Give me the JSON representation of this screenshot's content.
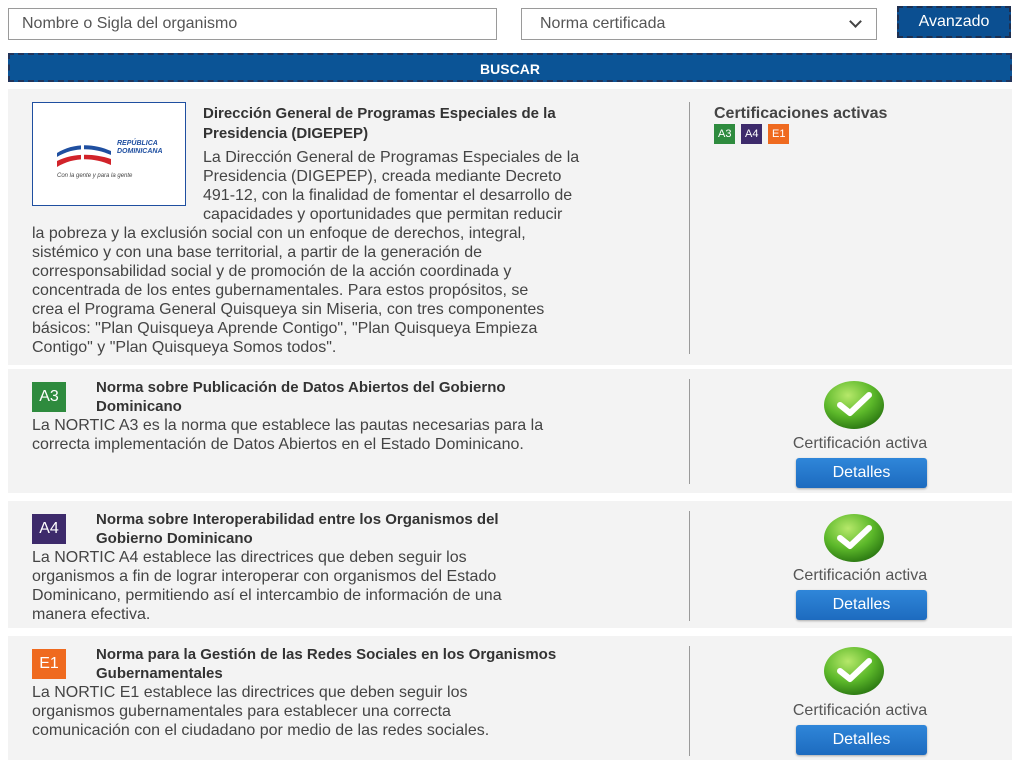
{
  "search": {
    "placeholder": "Nombre o Sigla del organismo"
  },
  "norma_select": {
    "selected": "Norma certificada"
  },
  "advanced_button": "Avanzado",
  "search_button": "BUSCAR",
  "organization": {
    "logo_text_line1": "REPÚBLICA",
    "logo_text_line2": "DOMINICANA",
    "logo_caption": "Con la gente y para la gente",
    "title_line1": "Dirección General de Programas Especiales de la",
    "title_line2": "Presidencia (DIGEPEP)",
    "description_lines_right": [
      "La Dirección General de Programas Especiales de la",
      "Presidencia (DIGEPEP), creada mediante Decreto",
      "491-12, con la finalidad de fomentar el desarrollo de",
      "capacidades y oportunidades que permitan reducir"
    ],
    "description_lines_full": [
      "la pobreza y la exclusión social con un enfoque de derechos, integral,",
      "sistémico y con una base territorial, a partir de la generación de",
      "corresponsabilidad social y de promoción de la acción coordinada y",
      "concentrada de los entes gubernamentales. Para estos propósitos, se",
      "crea el Programa General Quisqueya sin Miseria, con tres componentes",
      "básicos: \"Plan Quisqueya Aprende Contigo\", \"Plan Quisqueya Empieza",
      "Contigo\" y \"Plan Quisqueya Somos todos\"."
    ],
    "active_certs_label": "Certificaciones activas",
    "badges": [
      {
        "code": "A3",
        "color": "#2e8b3e"
      },
      {
        "code": "A4",
        "color": "#3d2a6b"
      },
      {
        "code": "E1",
        "color": "#ef6a1f"
      }
    ]
  },
  "norms": [
    {
      "code": "A3",
      "color": "#2e8b3e",
      "title_lines": [
        "Norma sobre Publicación de Datos Abiertos del Gobierno",
        "Dominicano"
      ],
      "desc_lines": [
        "La NORTIC A3 es la norma que establece las pautas necesarias para la",
        "correcta implementación de Datos Abiertos en el Estado Dominicano."
      ],
      "status": "Certificación activa",
      "details_label": "Detalles"
    },
    {
      "code": "A4",
      "color": "#3d2a6b",
      "title_lines": [
        "Norma sobre Interoperabilidad entre los Organismos del",
        "Gobierno Dominicano"
      ],
      "desc_lines": [
        "La NORTIC A4 establece las directrices que deben seguir los",
        "organismos a fin de lograr interoperar con organismos del Estado",
        "Dominicano, permitiendo así el intercambio de información de una",
        "manera efectiva."
      ],
      "status": "Certificación activa",
      "details_label": "Detalles"
    },
    {
      "code": "E1",
      "color": "#ef6a1f",
      "title_lines": [
        "Norma para la Gestión de las Redes Sociales en los Organismos",
        "Gubernamentales"
      ],
      "desc_lines": [
        "La NORTIC E1 establece las directrices que deben seguir los",
        "organismos gubernamentales para establecer una correcta",
        "comunicación con el ciudadano por medio de las redes sociales."
      ],
      "status": "Certificación activa",
      "details_label": "Detalles"
    }
  ]
}
